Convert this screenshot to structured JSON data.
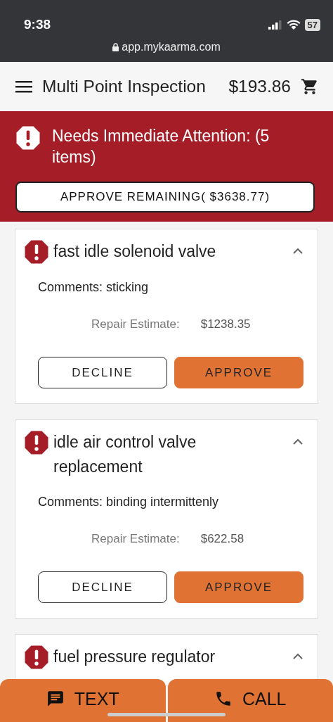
{
  "status_bar": {
    "time": "9:38",
    "battery": "57"
  },
  "browser": {
    "url": "app.mykaarma.com"
  },
  "header": {
    "title": "Multi Point Inspection",
    "total": "$193.86"
  },
  "banner": {
    "title": "Needs Immediate Attention: (5 items)",
    "approve_all": "APPROVE REMAINING( $3638.77)"
  },
  "items": [
    {
      "title": "fast idle solenoid valve",
      "expanded": true,
      "comments": "Comments: sticking",
      "estimate_label": "Repair Estimate:",
      "estimate": "$1238.35",
      "decline": "DECLINE",
      "approve": "APPROVE"
    },
    {
      "title": "idle air control valve replacement",
      "expanded": true,
      "comments": "Comments: binding intermittenly",
      "estimate_label": "Repair Estimate:",
      "estimate": "$622.58",
      "decline": "DECLINE",
      "approve": "APPROVE"
    },
    {
      "title": "fuel pressure regulator",
      "expanded": true
    }
  ],
  "bottom_bar": {
    "text": "TEXT",
    "call": "CALL"
  }
}
